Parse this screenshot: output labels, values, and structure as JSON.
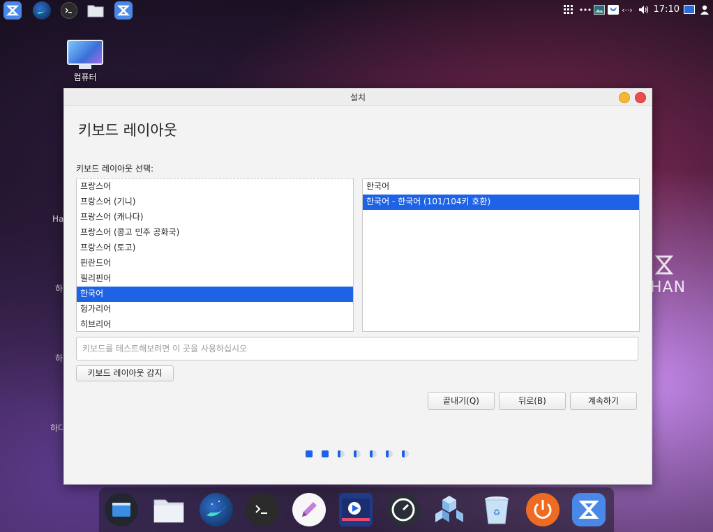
{
  "top_panel": {
    "clock": "17:10",
    "tray_arrows": "‹··›"
  },
  "desktop": {
    "computer_label": "컴퓨터",
    "peek_labels": [
      "Ha",
      "하",
      "하",
      "하다"
    ],
    "brand_text": "HAN"
  },
  "window": {
    "title": "설치",
    "heading": "키보드 레이아웃",
    "select_label": "키보드 레이아웃 선택:",
    "layouts": [
      {
        "label": "프랑스어",
        "selected": false
      },
      {
        "label": "프랑스어 (기니)",
        "selected": false
      },
      {
        "label": "프랑스어 (캐나다)",
        "selected": false
      },
      {
        "label": "프랑스어 (콩고 민주 공화국)",
        "selected": false
      },
      {
        "label": "프랑스어 (토고)",
        "selected": false
      },
      {
        "label": "핀란드어",
        "selected": false
      },
      {
        "label": "필리핀어",
        "selected": false
      },
      {
        "label": "한국어",
        "selected": true
      },
      {
        "label": "헝가리어",
        "selected": false
      },
      {
        "label": "히브리어",
        "selected": false
      }
    ],
    "variants": [
      {
        "label": "한국어",
        "selected": false
      },
      {
        "label": "한국어 - 한국어 (101/104키 호환)",
        "selected": true
      }
    ],
    "test_placeholder": "키보드를 테스트해보려면 이 곳을 사용하십시오",
    "detect_label": "키보드 레이아웃 감지",
    "quit_label": "끝내기(Q)",
    "back_label": "뒤로(B)",
    "continue_label": "계속하기",
    "progress": {
      "completed_steps": 2,
      "total_steps": 7
    }
  },
  "colors": {
    "accent": "#1e62e6",
    "minimize": "#f5b731",
    "close": "#ed4c4c"
  },
  "icons": {
    "top_launchers": [
      "hamonikr-logo-icon",
      "whale-browser-icon",
      "terminal-icon",
      "folder-icon",
      "hamonikr-app-icon"
    ],
    "tray": [
      "app-grid-icon",
      "more-icon",
      "image-viewer-icon",
      "app-tray-icon",
      "network-icon",
      "volume-icon",
      "display-icon",
      "user-icon"
    ],
    "dock": [
      "window-switcher-icon",
      "file-manager-icon",
      "whale-browser-icon",
      "terminal-icon",
      "text-editor-icon",
      "video-editor-icon",
      "system-monitor-icon",
      "package-manager-icon",
      "trash-icon",
      "power-icon",
      "hamonikr-logo-icon"
    ]
  }
}
